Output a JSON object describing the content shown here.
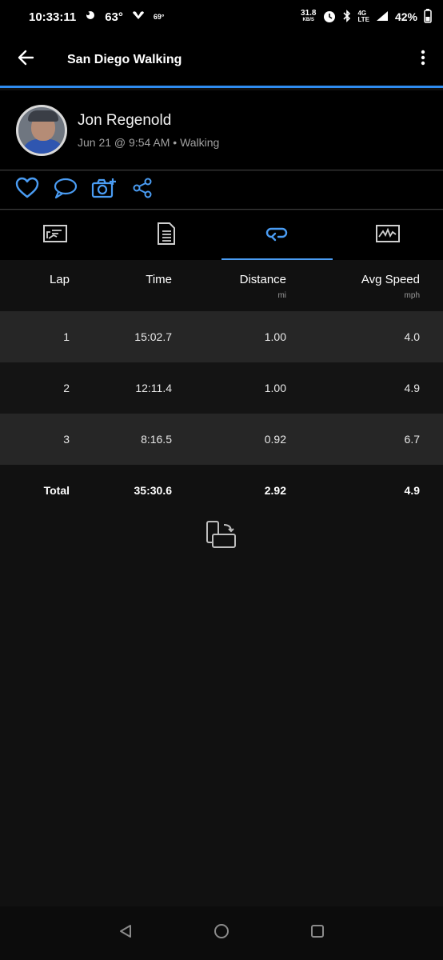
{
  "status_bar": {
    "time": "10:33:11",
    "temp1": "63°",
    "temp2": "69°",
    "net_speed": "31.8",
    "net_speed_unit": "KB/S",
    "network_top": "4G",
    "network_bottom": "LTE",
    "battery": "42%"
  },
  "app_bar": {
    "title": "San Diego Walking"
  },
  "profile": {
    "name": "Jon Regenold",
    "meta": "Jun 21 @ 9:54 AM • Walking"
  },
  "table": {
    "headers": {
      "lap": "Lap",
      "time": "Time",
      "distance": "Distance",
      "distance_unit": "mi",
      "avg_speed": "Avg Speed",
      "avg_speed_unit": "mph"
    },
    "rows": [
      {
        "lap": "1",
        "time": "15:02.7",
        "distance": "1.00",
        "avg_speed": "4.0"
      },
      {
        "lap": "2",
        "time": "12:11.4",
        "distance": "1.00",
        "avg_speed": "4.9"
      },
      {
        "lap": "3",
        "time": "8:16.5",
        "distance": "0.92",
        "avg_speed": "6.7"
      }
    ],
    "total": {
      "label": "Total",
      "time": "35:30.6",
      "distance": "2.92",
      "avg_speed": "4.9"
    }
  },
  "colors": {
    "accent": "#2f8cf0",
    "action_icon": "#4a9cf3",
    "background": "#111111"
  },
  "icons": {
    "back": "arrow-left-icon",
    "menu": "more-vert-icon",
    "like": "heart-icon",
    "comment": "comment-icon",
    "photo": "camera-add-icon",
    "share": "share-icon",
    "tab1": "chart-icon",
    "tab2": "document-icon",
    "tab3": "laps-icon",
    "tab4": "graph-icon",
    "rotate": "rotate-screen-icon"
  }
}
